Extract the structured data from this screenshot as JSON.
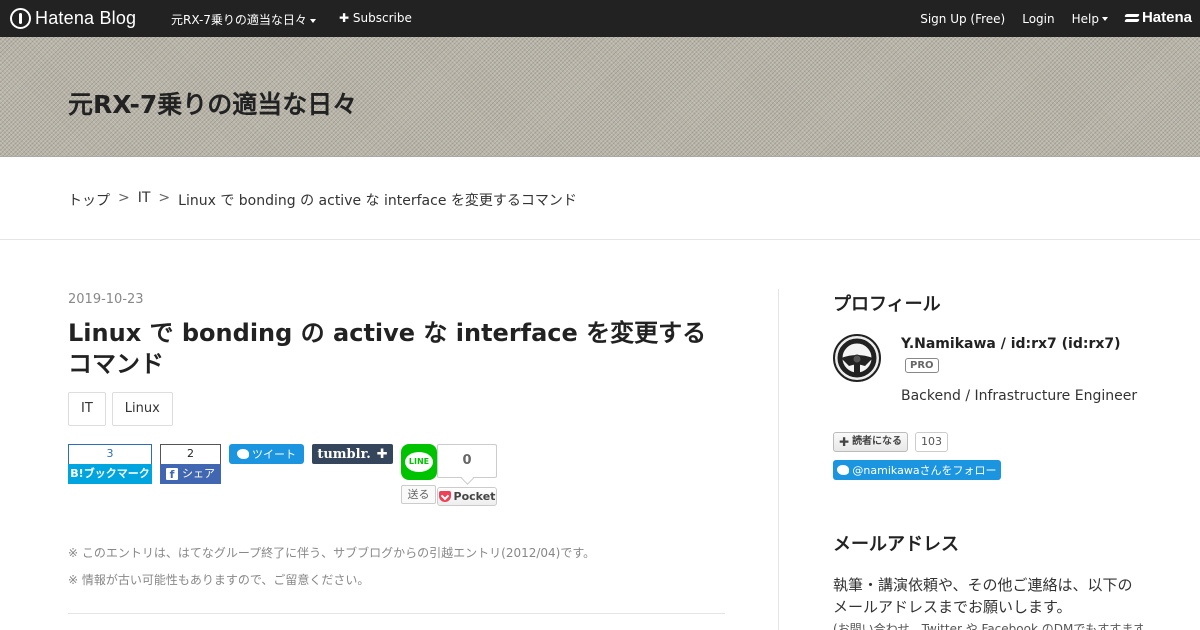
{
  "topbar": {
    "brand": "Hatena Blog",
    "blog_menu": "元RX-7乗りの適当な日々",
    "subscribe": "Subscribe",
    "signup": "Sign Up (Free)",
    "login": "Login",
    "help": "Help",
    "hatena": "Hatena"
  },
  "header": {
    "blog_title": "元RX-7乗りの適当な日々"
  },
  "breadcrumb": {
    "items": [
      "トップ",
      "IT",
      "Linux で bonding の active な interface を変更するコマンド"
    ],
    "separator": ">"
  },
  "entry": {
    "date": "2019-10-23",
    "title": "Linux で bonding の active な interface を変更するコマンド",
    "categories": [
      "IT",
      "Linux"
    ],
    "notes": [
      "※ このエントリは、はてなグループ終了に伴う、サブブログからの引越エントリ(2012/04)です。",
      "※ 情報が古い可能性もありますので、ご留意ください。"
    ]
  },
  "share": {
    "hatebu_count": "3",
    "hatebu_label": "B!ブックマーク",
    "facebook_count": "2",
    "facebook_label": "シェア",
    "twitter_label": "ツイート",
    "tumblr_label": "tumblr.",
    "line_label": "LINE",
    "line_send": "送る",
    "pocket_count": "0",
    "pocket_label": "Pocket"
  },
  "sidebar": {
    "profile_title": "プロフィール",
    "profile_name": "Y.Namikawa / id:rx7 (id:rx7)",
    "pro_badge": "PRO",
    "profile_desc": "Backend / Infrastructure Engineer",
    "reader_label": "読者になる",
    "reader_count": "103",
    "follow_label": "@namikawaさんをフォロー",
    "mail_title": "メールアドレス",
    "mail_text": "執筆・講演依頼や、その他ご連絡は、以下のメールアドレスまでお願いします。",
    "mail_sub": "(お問い合わせ、Twitter や Facebook のDMでもすすます"
  },
  "colors": {
    "topbar": "#222222",
    "hatebu": "#00a4de",
    "facebook": "#4267b2",
    "twitter": "#1b95e0",
    "tumblr": "#35465c",
    "line": "#00c300",
    "pocket": "#ee4056"
  }
}
